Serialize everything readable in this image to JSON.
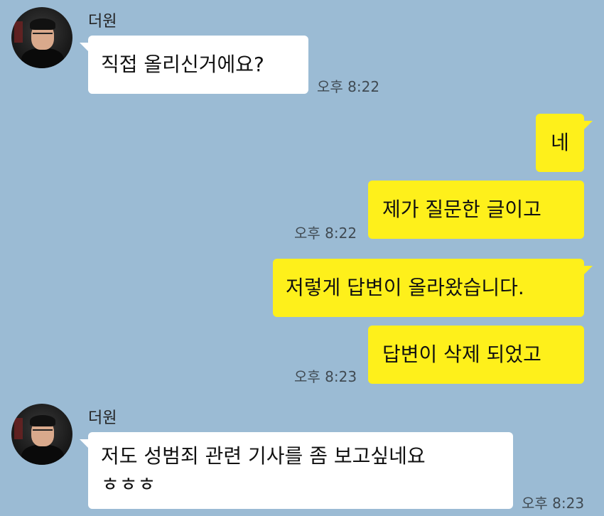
{
  "messages": [
    {
      "sender": "더원",
      "text": "직접 올리신거에요?",
      "time": "오후 8:22"
    },
    {
      "text": "네"
    },
    {
      "text": "제가 질문한 글이고",
      "time": "오후 8:22"
    },
    {
      "text": "저렇게 답변이 올라왔습니다."
    },
    {
      "text": "답변이 삭제 되었고",
      "time": "오후 8:23"
    },
    {
      "sender": "더원",
      "text_line1": "저도 성범죄 관련 기사를 좀 보고싶네요",
      "text_line2": "ㅎㅎㅎ",
      "time": "오후 8:23"
    }
  ],
  "colors": {
    "background": "#9bbbd4",
    "incoming_bubble": "#ffffff",
    "outgoing_bubble": "#fef01b"
  }
}
